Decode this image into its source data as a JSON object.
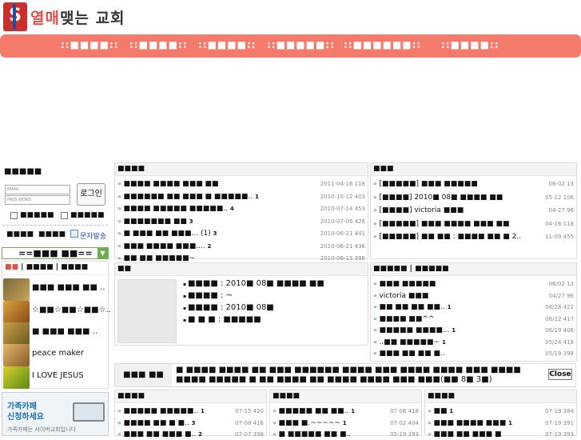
{
  "header": {
    "logo_text": "S",
    "title_red": "열매",
    "title_rest": "맺는 교회"
  },
  "nav": [
    {
      "label": "::■■■■::"
    },
    {
      "label": "::■■■■::"
    },
    {
      "label": "::■■■■::"
    },
    {
      "label": "::■■■■■::"
    },
    {
      "label": "::■■■■■■::"
    },
    {
      "label": "::■■■■::"
    }
  ],
  "login": {
    "title": "■■■■■",
    "email_placeholder": "EMAIL",
    "password_placeholder": "PASS WORD",
    "button": "로그인",
    "check1": "■■■■■",
    "check2": "■■■■■",
    "link1": "■■■■",
    "link2": "■■■■",
    "sms": "문자발송"
  },
  "select": {
    "value": "==■■■ ■■=="
  },
  "people": {
    "tab1": "■■",
    "tab2": "■■■■",
    "tab3": "■■■■",
    "items": [
      "■■■ ■■■ ■■ ..",
      "☆■■☆■■☆■■☆..",
      "■ ■■■ ■■■ ..",
      "peace maker",
      "I LOVE JESUS"
    ]
  },
  "ad": {
    "line1": "가족카페",
    "line2": "신청하세요",
    "line3": "가족카페는 사이버교회입니다"
  },
  "notice": {
    "title": "■■■■",
    "rows": [
      {
        "text": "■■■■ ■■■■ ■■■ ■■",
        "comments": "",
        "date": "2011-04-16 118"
      },
      {
        "text": "■■■■■■ ■■ ■■■ ■ ■■■■■..",
        "comments": "1",
        "date": "2010-10-12 403"
      },
      {
        "text": "■■■■ ■■■■■ ■■■■■..",
        "comments": "4",
        "date": "2010-07-14 453"
      },
      {
        "text": "■■■■■■■ ■■",
        "comments": "3",
        "date": "2010-07-06 426"
      },
      {
        "text": "■ ■■■ ■■ ■■■... (1)",
        "comments": "3",
        "date": "2010-06-21 441"
      },
      {
        "text": "■■■ ■■■■ ■■■....",
        "comments": "2",
        "date": "2010-06-21 436"
      },
      {
        "text": "■■ ■■ ■■■■■~",
        "comments": "",
        "date": "2010-06-15 398"
      }
    ]
  },
  "qa": {
    "title": "■■■",
    "rows": [
      {
        "text": "[■■■■■] ■■■ ■■■■■",
        "comments": "",
        "date": "06-02 13"
      },
      {
        "text": "[■■■■] 2010■ 08■ ■■■■ ■■",
        "comments": "",
        "date": "05-12 106"
      },
      {
        "text": "[■■■■] victoria ■■■",
        "comments": "",
        "date": "04-27 96"
      },
      {
        "text": "[■■■■■] ■■■ ■■■■ ■■■ ■■",
        "comments": "",
        "date": "04-16 118"
      },
      {
        "text": "[■■■■■] ■■ ■■ : ■■■■ ■■ ■ 2..",
        "comments": "",
        "date": "11-09 455"
      }
    ]
  },
  "photo": {
    "title": "■■",
    "rows": [
      "■■■■ : 2010■ 08■ ■■■■ ■■",
      "■■■■ : ~",
      "■■■■ : 2010■ 08■",
      "■ ■ ■ : ■■■■■"
    ]
  },
  "free": {
    "title": "■■■■■ | ■■■■■",
    "rows": [
      {
        "text": "■■■ ■■■■■",
        "comments": "",
        "date": "06/02 13"
      },
      {
        "text": "victoria ■■■",
        "comments": "",
        "date": "04/27 96"
      },
      {
        "text": "■■ ■■ ■■ ■■..",
        "comments": "1",
        "date": "06/28 422"
      },
      {
        "text": "■■■■ ■■^^",
        "comments": "",
        "date": "06/22 417"
      },
      {
        "text": "■■■■■ ■■■■...",
        "comments": "1",
        "date": "06/19 406"
      },
      {
        "text": "..■■ ■■■■■~",
        "comments": "1",
        "date": "05/24 418"
      },
      {
        "text": "■■■ ■■ ■■ ■..",
        "comments": "",
        "date": "05/19 398"
      }
    ]
  },
  "banner": {
    "label": "■■■ ■■",
    "text": "■ ■■■■ ■■■■ ■■ ■■■ ■■■■■■ ■■■■ ■■■ ■■■■ ■■■■ ■■■ ■■■■ ■■■■ ■■■■■ ■ ■■ ■■■■ ■■ ■■■■ ■■■■ ■■■ ■■■(■■ 8■ 3■)",
    "close": "Close"
  },
  "bottom1": {
    "title": "■■■■",
    "rows": [
      {
        "text": "■■■■■ ■■■■■..",
        "comments": "1",
        "date": "07-15 420"
      },
      {
        "text": "■■■■ ■■ ■ ■..",
        "comments": "3",
        "date": "07-08 416"
      },
      {
        "text": "■■■ ■■ ■■■ ■..",
        "comments": "2",
        "date": "07-07 398"
      }
    ]
  },
  "bottom2": {
    "title": "■■■■",
    "rows": [
      {
        "text": "■■■■■ ■■ ■■..",
        "comments": "1",
        "date": "07-06 418"
      },
      {
        "text": "■■■ ■.~~~~~",
        "comments": "1",
        "date": "07-02 404"
      },
      {
        "text": "■ ■■■■■ ■■ ■..",
        "comments": "",
        "date": "05-19 393"
      }
    ]
  },
  "bottom3": {
    "title": "■■■■",
    "rows": [
      {
        "text": "■■",
        "comments": "1",
        "date": "07-19 384"
      },
      {
        "text": "■■■ ■■■■ ■■■",
        "comments": "1",
        "date": "07-19 391"
      },
      {
        "text": "■■■ ■■ ■■■ ■",
        "comments": "",
        "date": "07-19 393"
      }
    ]
  },
  "colors": {
    "nav": "#f47a6b",
    "accent_green": "#2d9a2d",
    "brand_red": "#c9302c"
  }
}
